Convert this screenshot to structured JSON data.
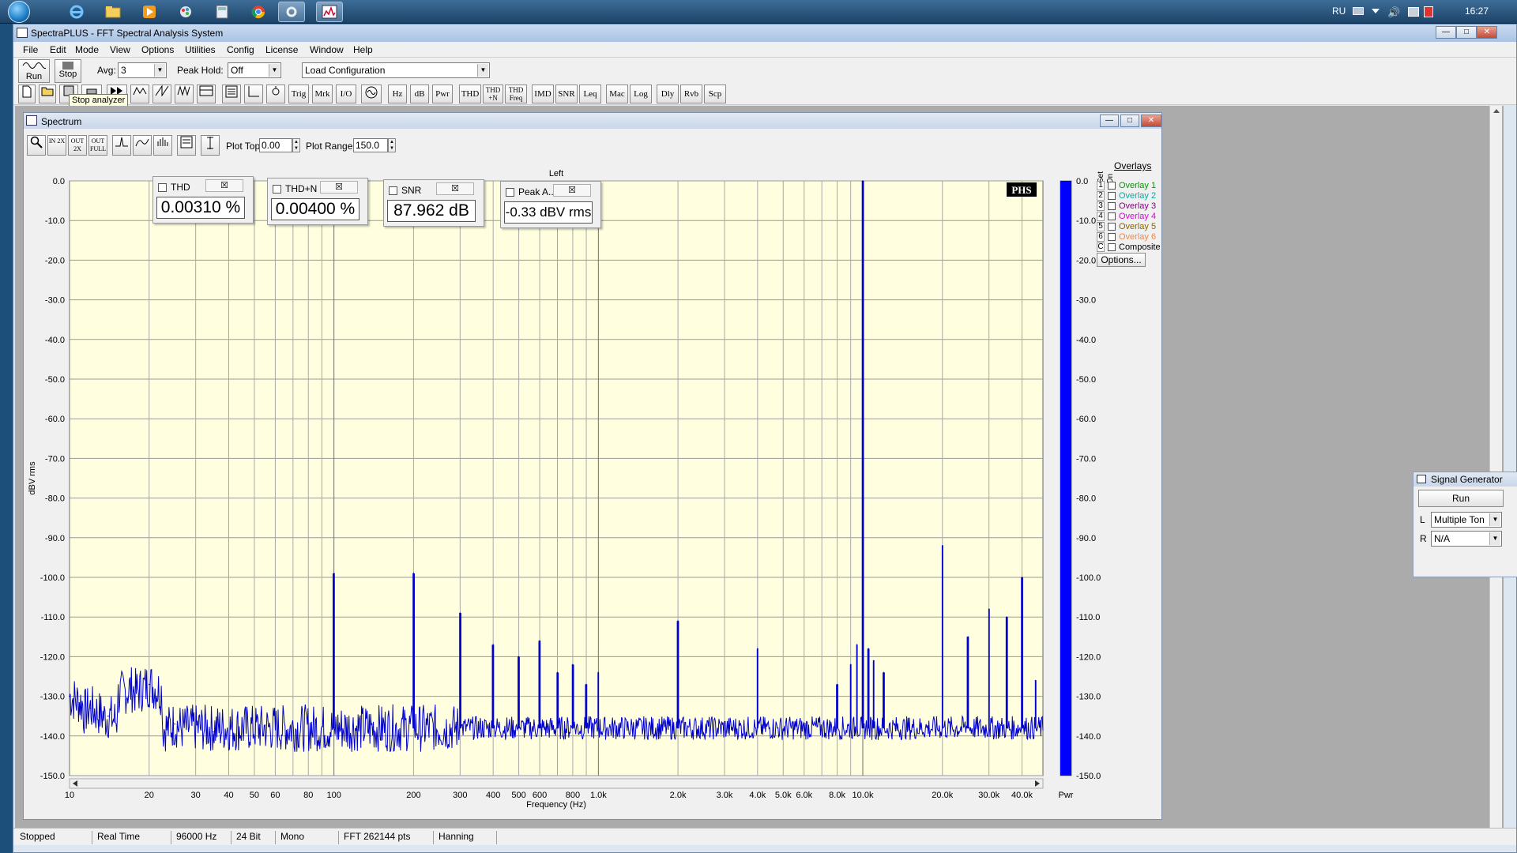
{
  "taskbar": {
    "clock": "16:27",
    "language": "RU",
    "icons": [
      "internet-explorer-icon",
      "folder-icon",
      "media-player-icon",
      "paint-icon",
      "calculator-icon",
      "chrome-icon",
      "settings-icon",
      "spectraplus-icon"
    ]
  },
  "window": {
    "title": "SpectraPLUS - FFT Spectral Analysis System",
    "menu": [
      "File",
      "Edit",
      "Mode",
      "View",
      "Options",
      "Utilities",
      "Config",
      "License",
      "Window",
      "Help"
    ]
  },
  "toolbar": {
    "run_label": "Run",
    "stop_label": "Stop",
    "avg_label": "Avg:",
    "avg_value": "3",
    "peak_hold_label": "Peak Hold:",
    "peak_hold_value": "Off",
    "load_config_value": "Load Configuration",
    "tooltip": "Stop analyzer",
    "buttons": [
      "Trig",
      "Mrk",
      "I/O",
      "Hz",
      "dB",
      "Pwr",
      "THD",
      "THD +N",
      "THD Freq",
      "IMD",
      "SNR",
      "Leq",
      "Mac",
      "Log",
      "Dly",
      "Rvb",
      "Scp"
    ]
  },
  "spectrum": {
    "title": "Spectrum",
    "plot_top_label": "Plot Top:",
    "plot_top_value": "0.00",
    "plot_range_label": "Plot Range:",
    "plot_range_value": "150.0",
    "zoom_buttons": [
      "IN 2X",
      "OUT 2X",
      "OUT FULL"
    ],
    "channel": "Left",
    "phs_logo": "PHS",
    "pwr_label": "Pwr",
    "y_ticks": [
      "0.0",
      "-10.0",
      "-20.0",
      "-30.0",
      "-40.0",
      "-50.0",
      "-60.0",
      "-70.0",
      "-80.0",
      "-90.0",
      "-100.0",
      "-110.0",
      "-120.0",
      "-130.0",
      "-140.0",
      "-150.0"
    ],
    "x_tick_labels": [
      "10",
      "20",
      "30",
      "40",
      "50",
      "60",
      "80",
      "100",
      "200",
      "300",
      "400",
      "500",
      "600",
      "800",
      "1.0k",
      "2.0k",
      "3.0k",
      "4.0k",
      "5.0k",
      "6.0k",
      "8.0k",
      "10.0k",
      "20.0k",
      "30.0k",
      "40.0k"
    ],
    "meters": [
      {
        "label": "THD",
        "value": "0.00310 %"
      },
      {
        "label": "THD+N",
        "value": "0.00400 %"
      },
      {
        "label": "SNR",
        "value": "87.962 dB"
      },
      {
        "label": "Peak A...",
        "value": "-0.33 dBV rms"
      }
    ],
    "overlays": {
      "title": "Overlays",
      "header_set": "Set",
      "header_on": "On",
      "items": [
        {
          "num": "1",
          "label": "Overlay 1",
          "color": "#009900"
        },
        {
          "num": "2",
          "label": "Overlay 2",
          "color": "#00aaaa"
        },
        {
          "num": "3",
          "label": "Overlay 3",
          "color": "#880088"
        },
        {
          "num": "4",
          "label": "Overlay 4",
          "color": "#dd00dd"
        },
        {
          "num": "5",
          "label": "Overlay 5",
          "color": "#886600"
        },
        {
          "num": "6",
          "label": "Overlay 6",
          "color": "#ee8844"
        },
        {
          "num": "C",
          "label": "Composite",
          "color": "#000000"
        }
      ],
      "options_label": "Options..."
    }
  },
  "chart_data": {
    "type": "line",
    "xlabel": "Frequency (Hz)",
    "ylabel": "dBV rms",
    "xscale": "log",
    "xlim": [
      10,
      48000
    ],
    "ylim": [
      -150,
      0
    ],
    "grid": true,
    "line_color": "#0000cc",
    "background_color": "#ffffe0",
    "noise_floor_db": -138,
    "points": [
      {
        "x": 10,
        "y": -130
      },
      {
        "x": 12,
        "y": -133
      },
      {
        "x": 14,
        "y": -135
      },
      {
        "x": 17,
        "y": -128
      },
      {
        "x": 20,
        "y": -127
      },
      {
        "x": 25,
        "y": -137
      },
      {
        "x": 35,
        "y": -139
      },
      {
        "x": 100,
        "y": -99
      },
      {
        "x": 200,
        "y": -99
      },
      {
        "x": 300,
        "y": -109
      },
      {
        "x": 400,
        "y": -117
      },
      {
        "x": 500,
        "y": -120
      },
      {
        "x": 600,
        "y": -116
      },
      {
        "x": 700,
        "y": -124
      },
      {
        "x": 800,
        "y": -122
      },
      {
        "x": 900,
        "y": -127
      },
      {
        "x": 1000,
        "y": -124
      },
      {
        "x": 2000,
        "y": -111
      },
      {
        "x": 4000,
        "y": -118
      },
      {
        "x": 8000,
        "y": -127
      },
      {
        "x": 9000,
        "y": -122
      },
      {
        "x": 9500,
        "y": -117
      },
      {
        "x": 10000,
        "y": 0
      },
      {
        "x": 10500,
        "y": -118
      },
      {
        "x": 11000,
        "y": -121
      },
      {
        "x": 12000,
        "y": -124
      },
      {
        "x": 20000,
        "y": -92
      },
      {
        "x": 25000,
        "y": -115
      },
      {
        "x": 30000,
        "y": -108
      },
      {
        "x": 35000,
        "y": -110
      },
      {
        "x": 40000,
        "y": -100
      },
      {
        "x": 45000,
        "y": -126
      }
    ],
    "level_bar": {
      "value": 0,
      "color": "#0000ff"
    }
  },
  "signal_generator": {
    "title": "Signal Generator",
    "run_label": "Run",
    "l_label": "L",
    "l_value": "Multiple Ton",
    "r_label": "R",
    "r_value": "N/A"
  },
  "statusbar": [
    "Stopped",
    "Real Time",
    "96000 Hz",
    "24 Bit",
    "Mono",
    "FFT 262144 pts",
    "Hanning"
  ]
}
